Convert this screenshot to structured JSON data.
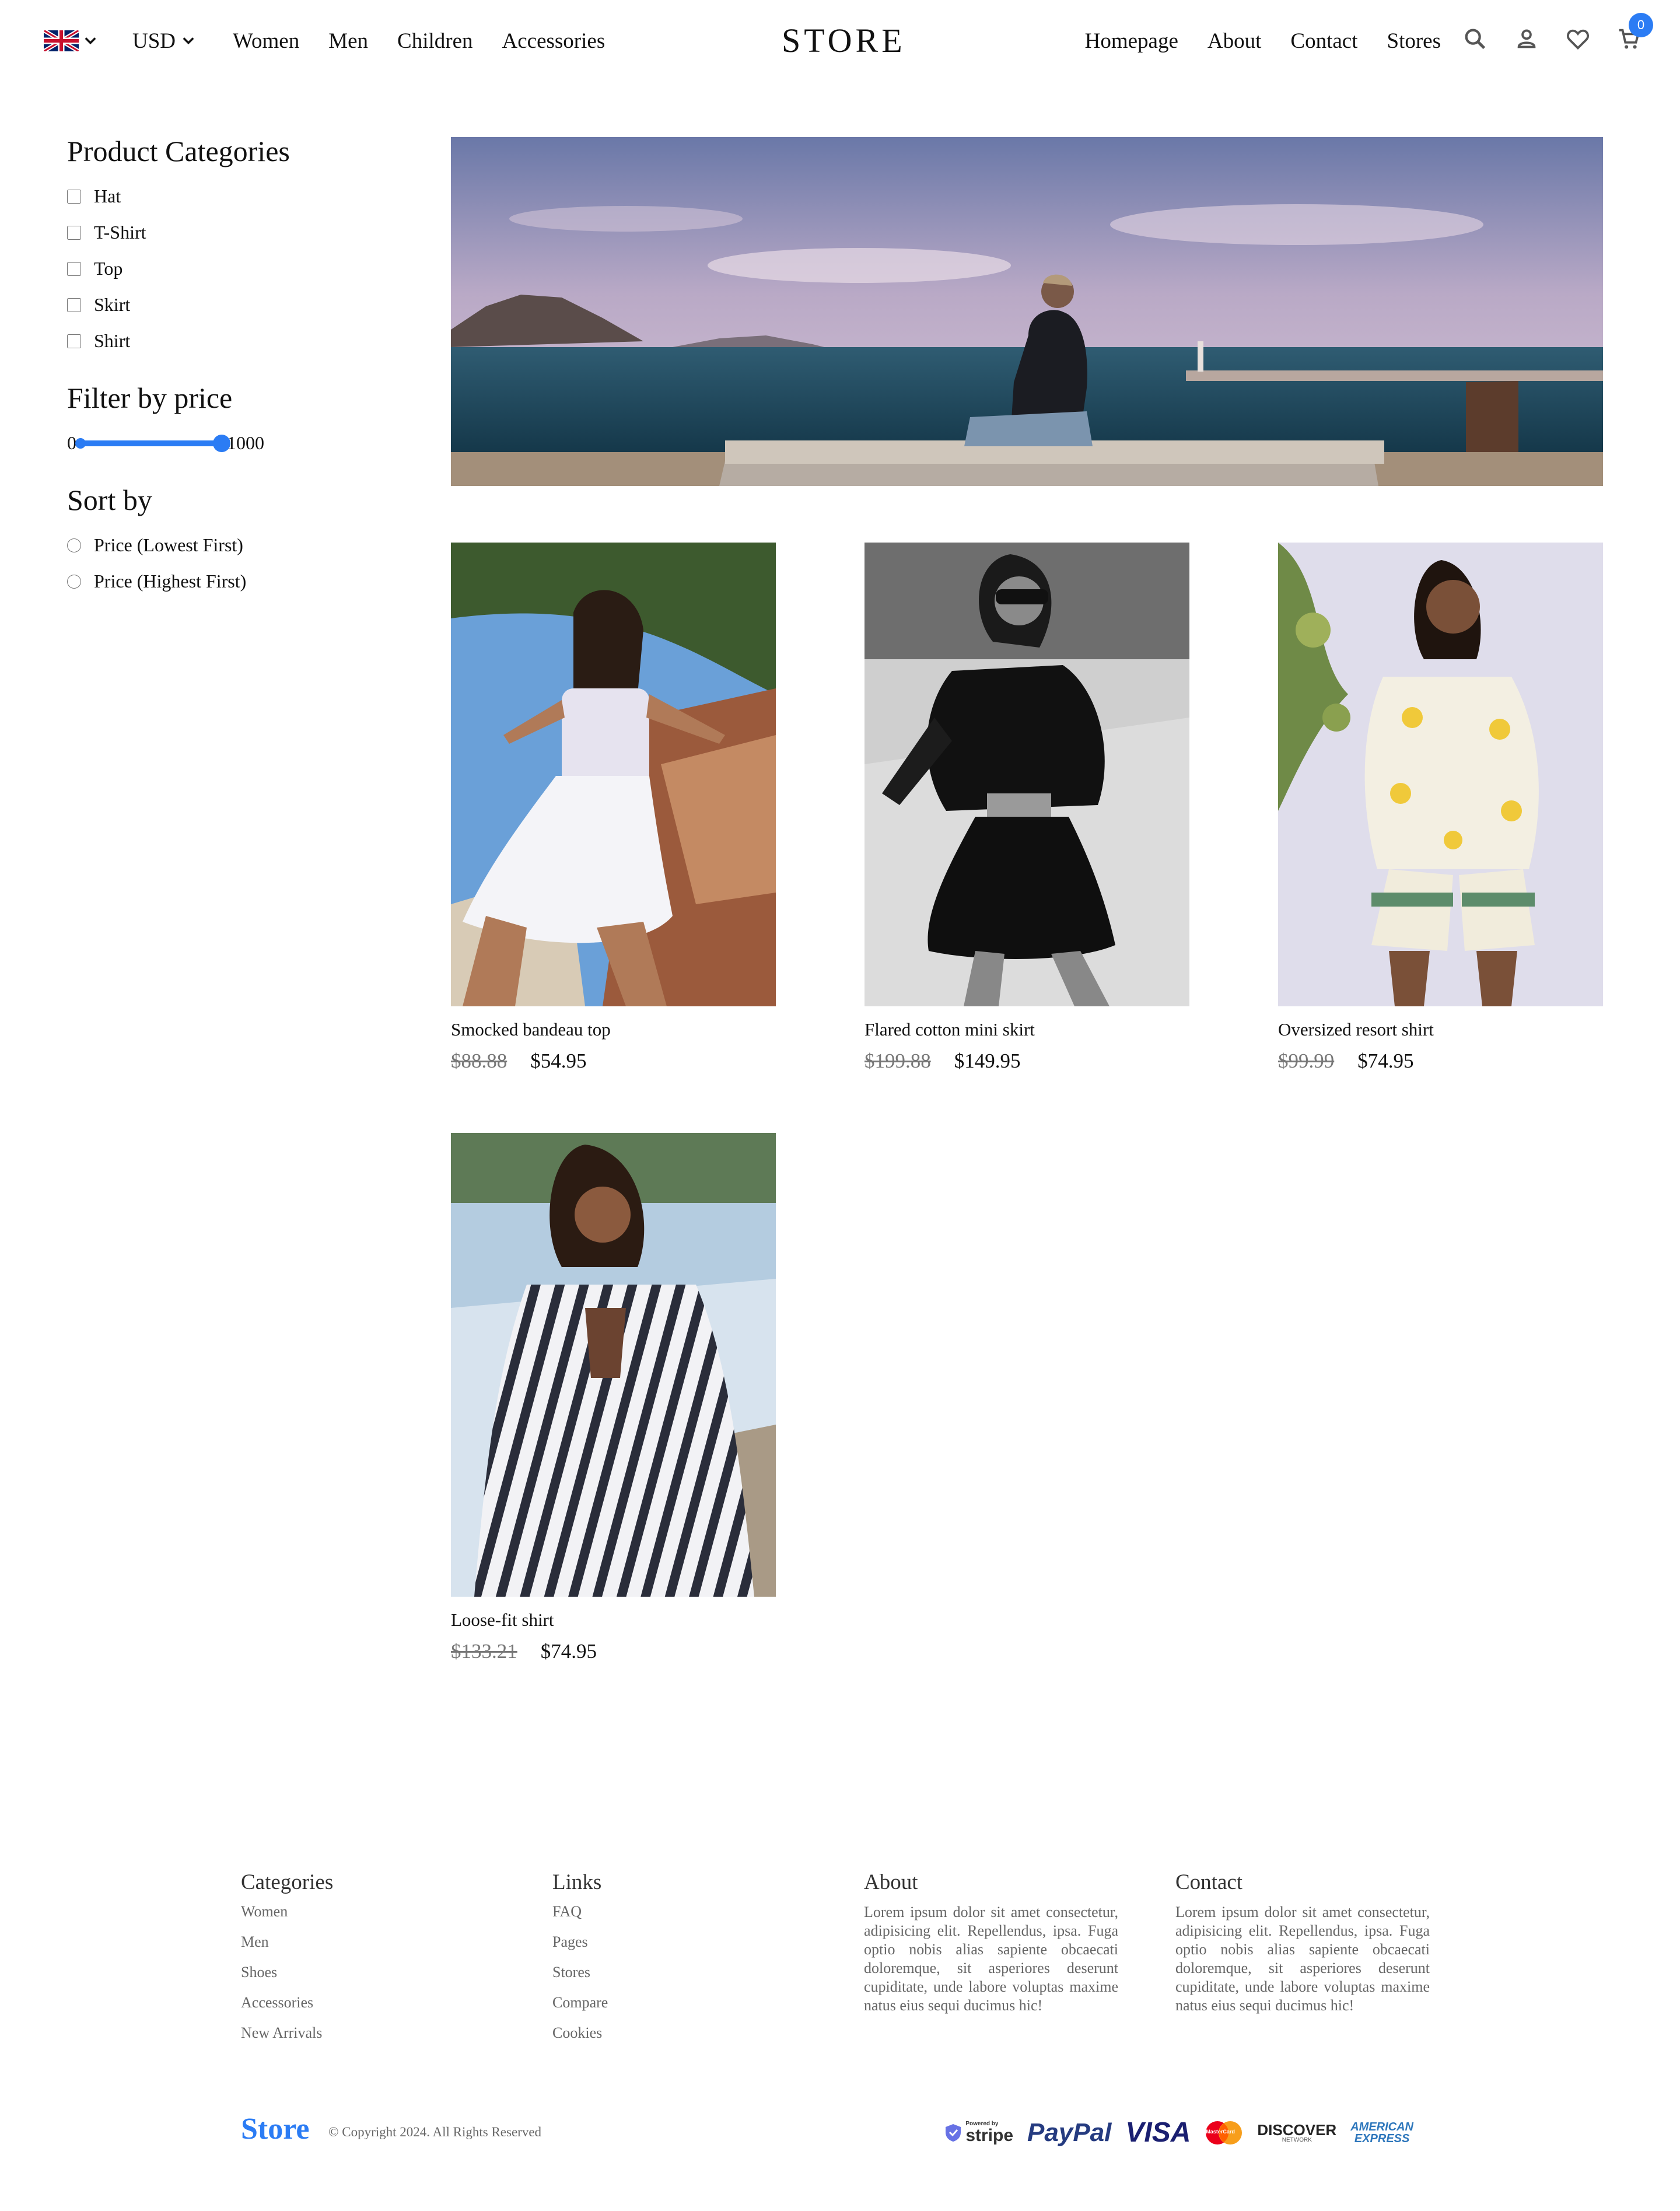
{
  "header": {
    "currency": "USD",
    "left_nav": [
      "Women",
      "Men",
      "Children",
      "Accessories"
    ],
    "logo": "STORE",
    "right_nav": [
      "Homepage",
      "About",
      "Contact",
      "Stores"
    ],
    "cart_count": "0",
    "icons": [
      "uk-flag-icon",
      "chevron-down-icon",
      "search-icon",
      "user-icon",
      "heart-icon",
      "cart-icon"
    ]
  },
  "sidebar": {
    "categories_title": "Product Categories",
    "categories": [
      "Hat",
      "T-Shirt",
      "Top",
      "Skirt",
      "Shirt"
    ],
    "price_title": "Filter by price",
    "price_min": "0",
    "price_max": "1000",
    "price_range_fill": 1.0,
    "sort_title": "Sort by",
    "sort_options": [
      "Price (Lowest First)",
      "Price (Highest First)"
    ]
  },
  "products": [
    {
      "name": "Smocked bandeau top",
      "old_price": "$88.88",
      "price": "$54.95"
    },
    {
      "name": "Flared cotton mini skirt",
      "old_price": "$199.88",
      "price": "$149.95"
    },
    {
      "name": "Oversized resort shirt",
      "old_price": "$99.99",
      "price": "$74.95"
    },
    {
      "name": "Loose-fit shirt",
      "old_price": "$133.21",
      "price": "$74.95"
    }
  ],
  "footer": {
    "categories_title": "Categories",
    "categories": [
      "Women",
      "Men",
      "Shoes",
      "Accessories",
      "New Arrivals"
    ],
    "links_title": "Links",
    "links": [
      "FAQ",
      "Pages",
      "Stores",
      "Compare",
      "Cookies"
    ],
    "about_title": "About",
    "about_text": "Lorem ipsum dolor sit amet consectetur, adipisicing elit. Repellendus, ipsa. Fuga optio nobis alias sapiente obcaecati doloremque, sit asperiores deserunt cupiditate, unde labore voluptas maxime natus eius sequi ducimus hic!",
    "contact_title": "Contact",
    "contact_text": "Lorem ipsum dolor sit amet consectetur, adipisicing elit. Repellendus, ipsa. Fuga optio nobis alias sapiente obcaecati doloremque, sit asperiores deserunt cupiditate, unde labore voluptas maxime natus eius sequi ducimus hic!",
    "brand": "Store",
    "copyright": "© Copyright 2024. All Rights Reserved",
    "payments": {
      "stripe_small": "Powered by",
      "stripe": "stripe",
      "paypal": "PayPal",
      "visa": "VISA",
      "mastercard": "MasterCard",
      "discover": "DISCOVER",
      "discover_sub": "NETWORK",
      "amex_line1": "AMERICAN",
      "amex_line2": "EXPRESS"
    }
  },
  "colors": {
    "accent": "#2b7cf4",
    "text": "#111111",
    "muted": "#666666"
  }
}
